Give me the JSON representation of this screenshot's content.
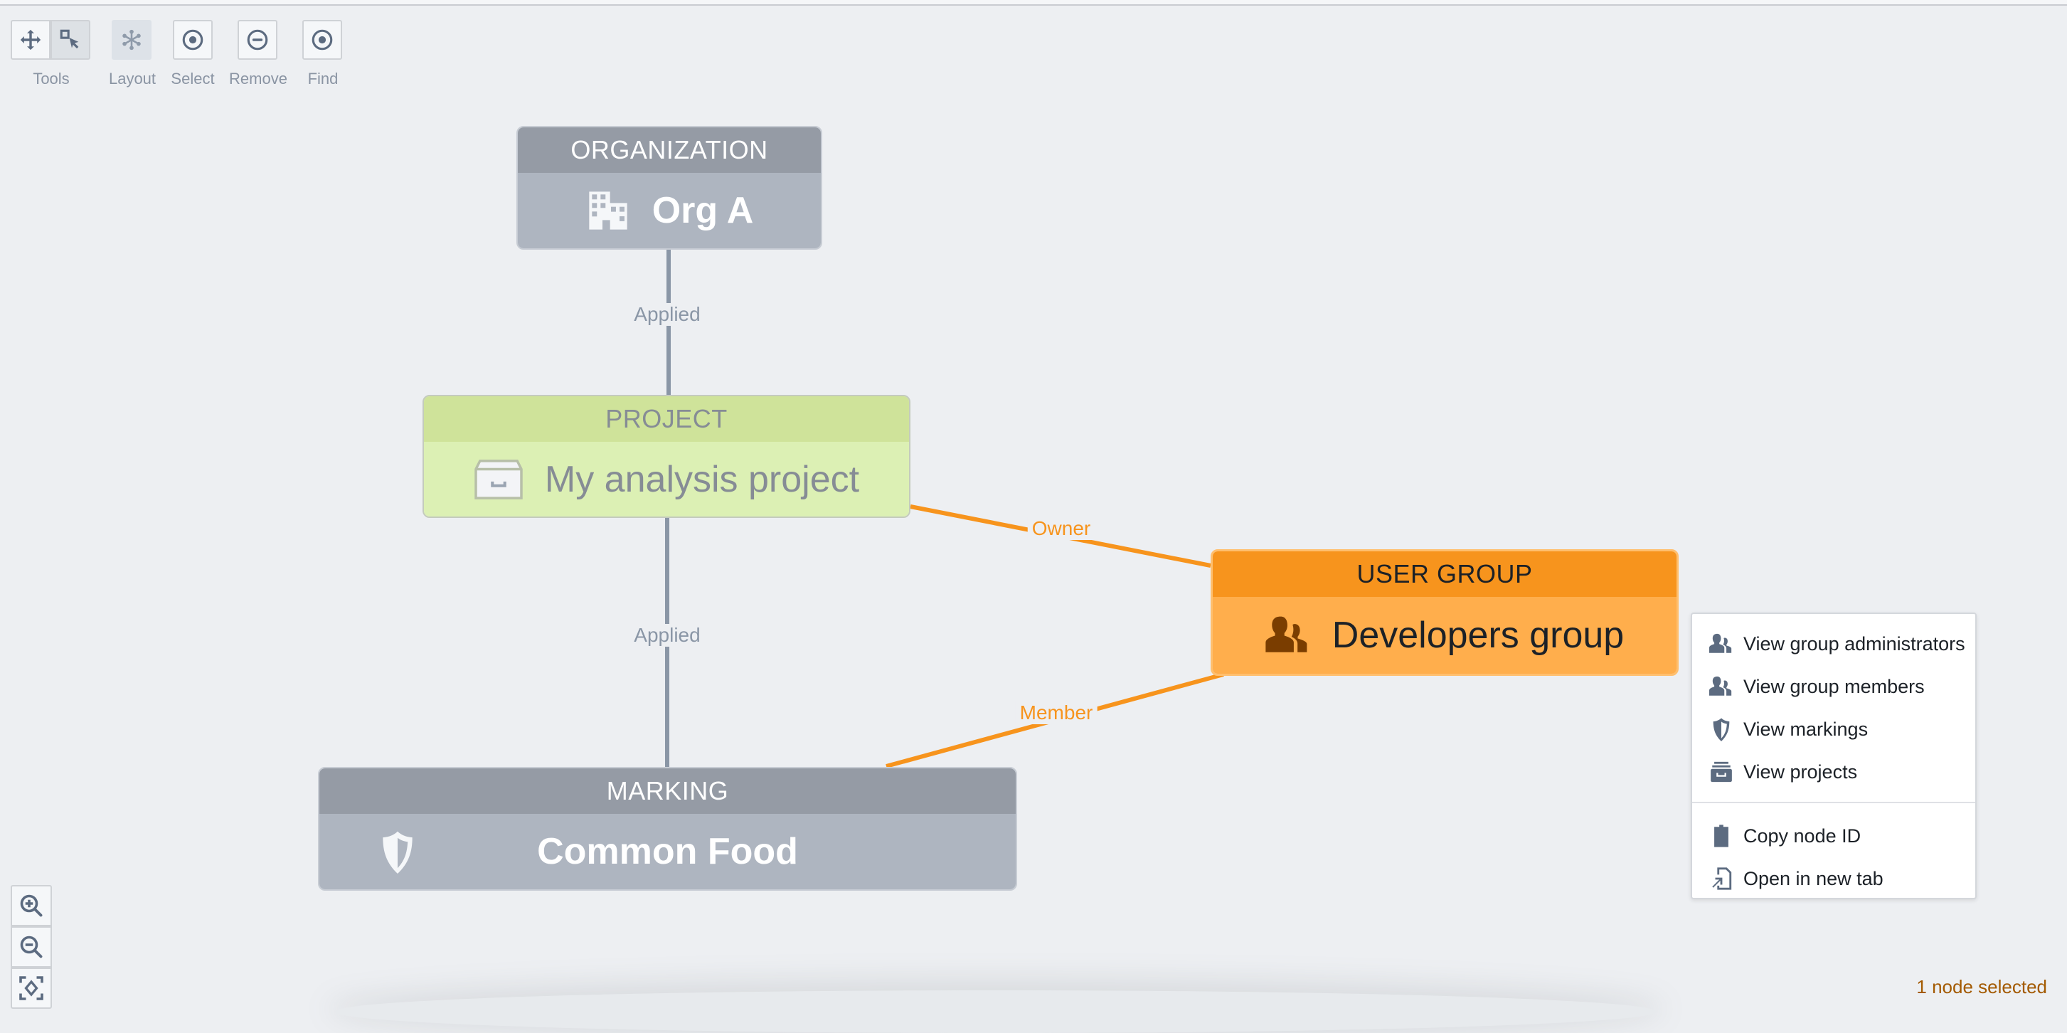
{
  "toolbar": {
    "tools_label": "Tools",
    "layout_label": "Layout",
    "select_label": "Select",
    "remove_label": "Remove",
    "find_label": "Find",
    "icons": {
      "pan": "move-icon",
      "select_box": "box-select-icon",
      "layout": "graph-layout-icon",
      "select": "target-icon",
      "remove": "remove-icon",
      "find": "target-icon"
    }
  },
  "nodes": {
    "organization": {
      "type": "ORGANIZATION",
      "name": "Org A",
      "icon": "building-icon"
    },
    "project": {
      "type": "PROJECT",
      "name": "My analysis project",
      "icon": "archive-icon"
    },
    "user_group": {
      "type": "USER GROUP",
      "name": "Developers group",
      "icon": "people-icon",
      "selected": true
    },
    "marking": {
      "type": "MARKING",
      "name": "Common Food",
      "icon": "shield-icon"
    }
  },
  "edges": [
    {
      "from": "organization",
      "to": "project",
      "label": "Applied",
      "color": "#8a96a6"
    },
    {
      "from": "project",
      "to": "marking",
      "label": "Applied",
      "color": "#8a96a6"
    },
    {
      "from": "project",
      "to": "user_group",
      "label": "Owner",
      "color": "#f7941d"
    },
    {
      "from": "marking",
      "to": "user_group",
      "label": "Member",
      "color": "#f7941d"
    }
  ],
  "context_menu": {
    "items": [
      {
        "label": "View group administrators",
        "icon": "people-icon"
      },
      {
        "label": "View group members",
        "icon": "people-icon"
      },
      {
        "label": "View markings",
        "icon": "shield-icon"
      },
      {
        "label": "View projects",
        "icon": "archive-icon"
      }
    ],
    "secondary_items": [
      {
        "label": "Copy node ID",
        "icon": "clipboard-icon"
      },
      {
        "label": "Open in new tab",
        "icon": "share-icon"
      }
    ]
  },
  "zoom_controls": {
    "zoom_in": "zoom-in-icon",
    "zoom_out": "zoom-out-icon",
    "fit": "zoom-to-fit-icon"
  },
  "status": {
    "selection": "1 node selected"
  },
  "colors": {
    "accent_orange": "#f7941d",
    "edge_gray": "#8a96a6",
    "status_text": "#a35a00"
  }
}
